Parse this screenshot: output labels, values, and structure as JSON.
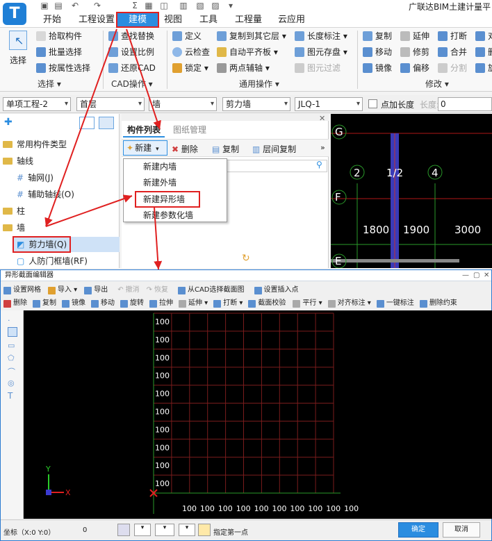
{
  "app": {
    "title": "广联达BIM土建计量平",
    "logo": "T"
  },
  "tabs": [
    "开始",
    "工程设置",
    "建模",
    "视图",
    "工具",
    "工程量",
    "云应用"
  ],
  "ribbon": {
    "select": {
      "big": "选择",
      "items": [
        "拾取构件",
        "批量选择",
        "按属性选择"
      ],
      "group": "选择"
    },
    "cad": {
      "items": [
        "查找替换",
        "设置比例",
        "还原CAD"
      ],
      "group": "CAD操作"
    },
    "general": {
      "col1": [
        "定义",
        "云检查",
        "锁定"
      ],
      "col2": [
        "复制到其它层",
        "自动平齐板",
        "两点辅轴"
      ],
      "col3": [
        "长度标注",
        "图元存盘",
        "图元过滤"
      ],
      "group": "通用操作"
    },
    "modify": {
      "col1": [
        "复制",
        "移动",
        "镜像"
      ],
      "col2": [
        "延伸",
        "修剪",
        "偏移"
      ],
      "col3": [
        "打断",
        "合并",
        "分割"
      ],
      "col4": [
        "对",
        "删",
        "旋"
      ],
      "group": "修改"
    }
  },
  "propbar": {
    "project": "单项工程-2",
    "floor": "首层",
    "category": "墙",
    "type": "剪力墙",
    "item": "JLQ-1",
    "point_length": "点加长度",
    "length_label": "长度:",
    "length_value": "0"
  },
  "tree": {
    "items": [
      {
        "label": "常用构件类型",
        "icon": "folder-icon"
      },
      {
        "label": "轴线",
        "icon": "folder-icon"
      },
      {
        "label": "轴网(J)",
        "icon": "grid-icon"
      },
      {
        "label": "辅助轴线(O)",
        "icon": "aux-grid-icon"
      },
      {
        "label": "柱",
        "icon": "folder-icon"
      },
      {
        "label": "墙",
        "icon": "folder-icon"
      },
      {
        "label": "剪力墙(Q)",
        "icon": "shear-wall-icon"
      },
      {
        "label": "人防门框墙(RF)",
        "icon": "wall-icon"
      }
    ]
  },
  "comp": {
    "tab_active": "构件列表",
    "tab_inactive": "图纸管理",
    "new": "新建",
    "delete": "删除",
    "copy": "复制",
    "floor_copy": "层间复制"
  },
  "context_menu": [
    "新建内墙",
    "新建外墙",
    "新建异形墙",
    "新建参数化墙"
  ],
  "cad": {
    "axes": [
      "G",
      "F",
      "E"
    ],
    "cols": [
      "2",
      "1/2",
      "4"
    ],
    "dims": [
      "1800",
      "1900",
      "3000"
    ]
  },
  "editor": {
    "title": "异形截面编辑器",
    "tb1": [
      "设置网格",
      "导入",
      "导出",
      "撤消",
      "恢复",
      "从CAD选择截面图",
      "设置插入点"
    ],
    "tb2": [
      "删除",
      "复制",
      "镜像",
      "移动",
      "旋转",
      "拉伸",
      "延伸",
      "打断",
      "截面校验",
      "平行",
      "对齐标注",
      "一键标注",
      "删除约束"
    ],
    "grid_v": [
      "100",
      "100",
      "100",
      "100",
      "100",
      "100",
      "100",
      "100",
      "100",
      "100"
    ],
    "grid_h": [
      "100",
      "100",
      "100",
      "100",
      "100",
      "100",
      "100",
      "100",
      "100",
      "100"
    ],
    "axis_x": "X",
    "axis_y": "Y",
    "coord": "坐标（X:0 Y:0）",
    "coord_val": "0",
    "hint": "指定第一点",
    "ok": "确定",
    "cancel": "取消"
  },
  "colors": {
    "accent": "#2b8de0",
    "highlight": "#e02020",
    "grid": "#7a1c1c",
    "wall": "#4040c0"
  }
}
